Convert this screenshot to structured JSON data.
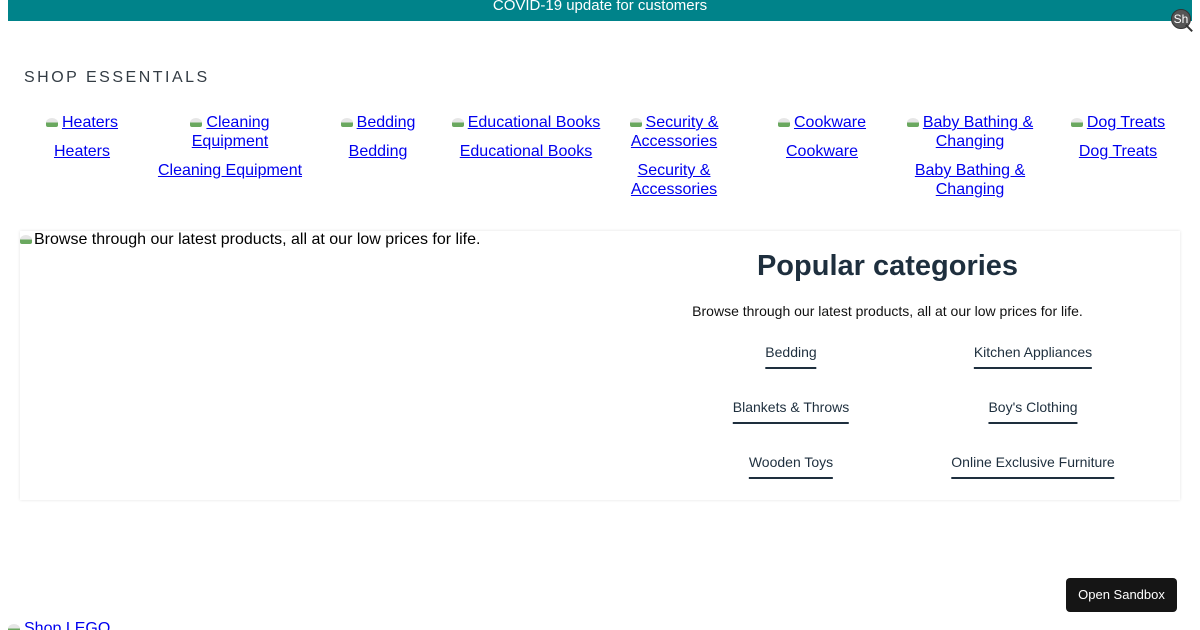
{
  "banner": {
    "text": "COVID-19 update for customers"
  },
  "search": {
    "icon": "search-icon",
    "alt": "Sh"
  },
  "essentials": {
    "title": "SHOP ESSENTIALS",
    "items": [
      {
        "image_alt": "Heaters",
        "label": "Heaters"
      },
      {
        "image_alt": "Cleaning Equipment",
        "label": "Cleaning Equipment"
      },
      {
        "image_alt": "Bedding",
        "label": "Bedding"
      },
      {
        "image_alt": "Educational Books",
        "label": "Educational Books"
      },
      {
        "image_alt": "Security & Accessories",
        "label": "Security & Accessories"
      },
      {
        "image_alt": "Cookware",
        "label": "Cookware"
      },
      {
        "image_alt": "Baby Bathing & Changing",
        "label": "Baby Bathing & Changing"
      },
      {
        "image_alt": "Dog Treats",
        "label": "Dog Treats"
      }
    ]
  },
  "popular": {
    "image_alt": "Browse through our latest products, all at our low prices for life.",
    "title": "Popular categories",
    "subtitle": "Browse through our latest products, all at our low prices for life.",
    "links": [
      "Bedding",
      "Kitchen Appliances",
      "Blankets & Throws",
      "Boy's Clothing",
      "Wooden Toys",
      "Online Exclusive Furniture"
    ]
  },
  "sandbox_button": "Open Sandbox",
  "lego": {
    "image_alt": "Shop LEGO"
  },
  "colors": {
    "banner": "#00838a",
    "heading": "#1e2f3e",
    "link": "#0000ee",
    "button": "#151515"
  }
}
